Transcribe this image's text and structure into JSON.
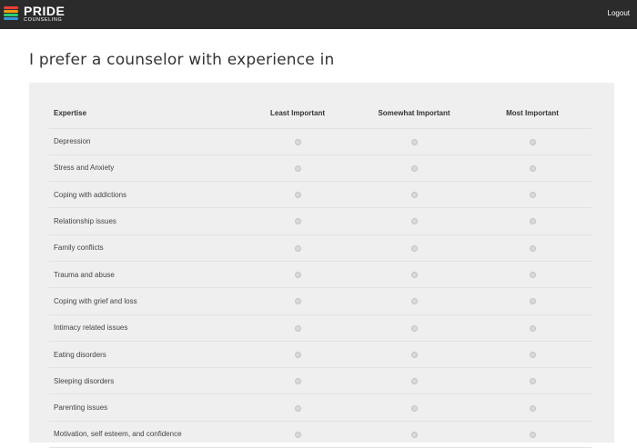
{
  "header": {
    "brand_title": "PRIDE",
    "brand_subtitle": "COUNSELING",
    "logout_label": "Logout",
    "brand_colors": [
      "#e8403a",
      "#f39c12",
      "#2ecc71",
      "#3498db",
      "#8e44ad"
    ]
  },
  "page": {
    "title": "I prefer a counselor with experience in"
  },
  "table": {
    "headers": {
      "expertise": "Expertise",
      "least": "Least Important",
      "somewhat": "Somewhat Important",
      "most": "Most Important"
    },
    "rows": [
      "Depression",
      "Stress and Anxiety",
      "Coping with addictions",
      "Relationship issues",
      "Family conflicts",
      "Trauma and abuse",
      "Coping with grief and loss",
      "Intimacy related issues",
      "Eating disorders",
      "Sleeping disorders",
      "Parenting issues",
      "Motivation, self esteem, and confidence"
    ]
  }
}
